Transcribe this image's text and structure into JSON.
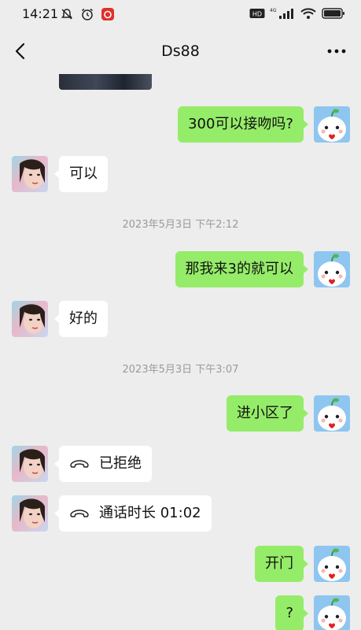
{
  "status": {
    "time": "14:21"
  },
  "nav": {
    "title": "Ds88"
  },
  "messages": {
    "m1": "300可以接吻吗?",
    "m2": "可以",
    "t1": "2023年5月3日 下午2:12",
    "m3": "那我来3的就可以",
    "m4": "好的",
    "t2": "2023年5月3日 下午3:07",
    "m5": "进小区了",
    "m6": "已拒绝",
    "m7": "通话时长 01:02",
    "m8": "开门",
    "m9": "?"
  }
}
